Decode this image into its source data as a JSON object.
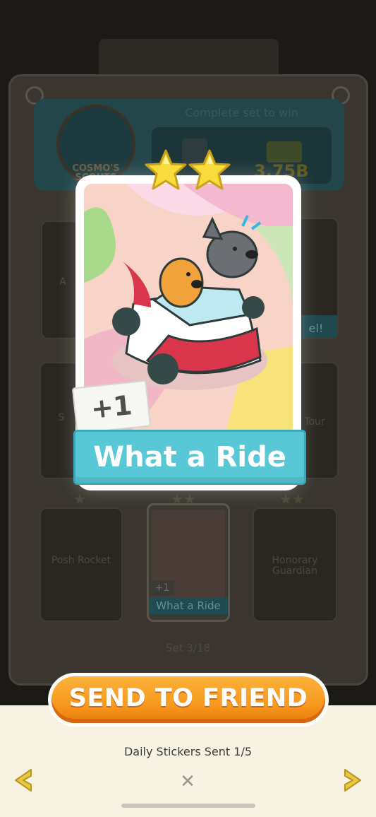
{
  "background": {
    "set_name": "COSMO'S SCOUTS",
    "complete_text": "Complete set to win",
    "prize_value": "3.75B",
    "cards": [
      {
        "label": "A"
      },
      {
        "label": "el!"
      },
      {
        "label": "S"
      },
      {
        "label": "Tour"
      },
      {
        "label": "Posh Rocket"
      },
      {
        "label": "What a Ride"
      },
      {
        "label": "Honorary Guardian"
      }
    ],
    "mini_card_plus": "+1",
    "set_progress": "Set 3/18"
  },
  "sticker": {
    "stars": 2,
    "plus_label": "+1",
    "name": "What a Ride"
  },
  "send_button": {
    "label": "SEND TO FRIEND"
  },
  "daily_sent": "Daily Stickers Sent 1/5",
  "colors": {
    "button_orange": "#f79a1f",
    "banner_teal": "#58c7d6",
    "arrow_yellow": "#e8c646",
    "panel_cream": "#f7f2e1"
  },
  "icons": {
    "left": "chevron-left-icon",
    "right": "chevron-right-icon",
    "close": "close-icon",
    "star": "star-icon"
  }
}
